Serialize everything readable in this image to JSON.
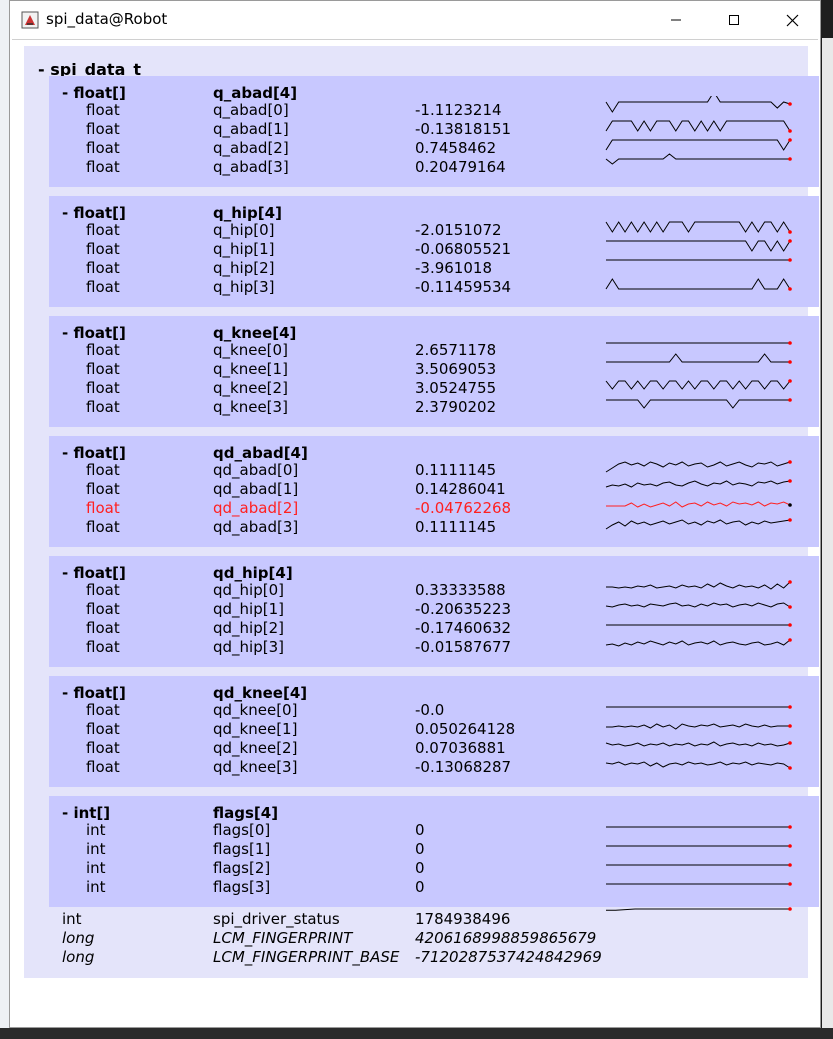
{
  "window": {
    "title": "spi_data@Robot",
    "controls": {
      "minimize": "minimize-icon",
      "maximize": "maximize-icon",
      "close": "close-icon"
    }
  },
  "root": {
    "label": "- spi_data_t"
  },
  "groups": [
    {
      "type": "- float[]",
      "name": "q_abad[4]",
      "rows": [
        {
          "type": "float",
          "name": "q_abad[0]",
          "value": "-1.1123214"
        },
        {
          "type": "float",
          "name": "q_abad[1]",
          "value": "-0.13818151"
        },
        {
          "type": "float",
          "name": "q_abad[2]",
          "value": "0.7458462"
        },
        {
          "type": "float",
          "name": "q_abad[3]",
          "value": "0.20479164"
        }
      ]
    },
    {
      "type": "- float[]",
      "name": "q_hip[4]",
      "rows": [
        {
          "type": "float",
          "name": "q_hip[0]",
          "value": "-2.0151072"
        },
        {
          "type": "float",
          "name": "q_hip[1]",
          "value": "-0.06805521"
        },
        {
          "type": "float",
          "name": "q_hip[2]",
          "value": "-3.961018"
        },
        {
          "type": "float",
          "name": "q_hip[3]",
          "value": "-0.11459534"
        }
      ]
    },
    {
      "type": "- float[]",
      "name": "q_knee[4]",
      "rows": [
        {
          "type": "float",
          "name": "q_knee[0]",
          "value": "2.6571178"
        },
        {
          "type": "float",
          "name": "q_knee[1]",
          "value": "3.5069053"
        },
        {
          "type": "float",
          "name": "q_knee[2]",
          "value": "3.0524755"
        },
        {
          "type": "float",
          "name": "q_knee[3]",
          "value": "2.3790202"
        }
      ]
    },
    {
      "type": "- float[]",
      "name": "qd_abad[4]",
      "rows": [
        {
          "type": "float",
          "name": "qd_abad[0]",
          "value": "0.1111145"
        },
        {
          "type": "float",
          "name": "qd_abad[1]",
          "value": "0.14286041"
        },
        {
          "type": "float",
          "name": "qd_abad[2]",
          "value": "-0.04762268",
          "highlight": true
        },
        {
          "type": "float",
          "name": "qd_abad[3]",
          "value": "0.1111145"
        }
      ]
    },
    {
      "type": "- float[]",
      "name": "qd_hip[4]",
      "rows": [
        {
          "type": "float",
          "name": "qd_hip[0]",
          "value": "0.33333588"
        },
        {
          "type": "float",
          "name": "qd_hip[1]",
          "value": "-0.20635223"
        },
        {
          "type": "float",
          "name": "qd_hip[2]",
          "value": "-0.17460632"
        },
        {
          "type": "float",
          "name": "qd_hip[3]",
          "value": "-0.01587677"
        }
      ]
    },
    {
      "type": "- float[]",
      "name": "qd_knee[4]",
      "rows": [
        {
          "type": "float",
          "name": "qd_knee[0]",
          "value": "-0.0"
        },
        {
          "type": "float",
          "name": "qd_knee[1]",
          "value": "0.050264128"
        },
        {
          "type": "float",
          "name": "qd_knee[2]",
          "value": "0.07036881"
        },
        {
          "type": "float",
          "name": "qd_knee[3]",
          "value": "-0.13068287"
        }
      ]
    },
    {
      "type": "- int[]",
      "name": "flags[4]",
      "rows": [
        {
          "type": "int",
          "name": "flags[0]",
          "value": "0"
        },
        {
          "type": "int",
          "name": "flags[1]",
          "value": "0"
        },
        {
          "type": "int",
          "name": "flags[2]",
          "value": "0"
        },
        {
          "type": "int",
          "name": "flags[3]",
          "value": "0"
        }
      ]
    }
  ],
  "extra_rows": [
    {
      "type": "int",
      "name": "spi_driver_status",
      "value": "1784938496"
    },
    {
      "type": "long",
      "name": "LCM_FINGERPRINT",
      "value": "4206168998859865679",
      "italic": true
    },
    {
      "type": "long",
      "name": "LCM_FINGERPRINT_BASE",
      "value": "-7120287537424842969",
      "italic": true
    }
  ],
  "colors": {
    "group_bg": "#c8c8ff",
    "outer_bg": "#e4e4fa",
    "highlight": "#ff2020",
    "sparkline": "#000000",
    "spark_end_marker": "#ff0000"
  }
}
